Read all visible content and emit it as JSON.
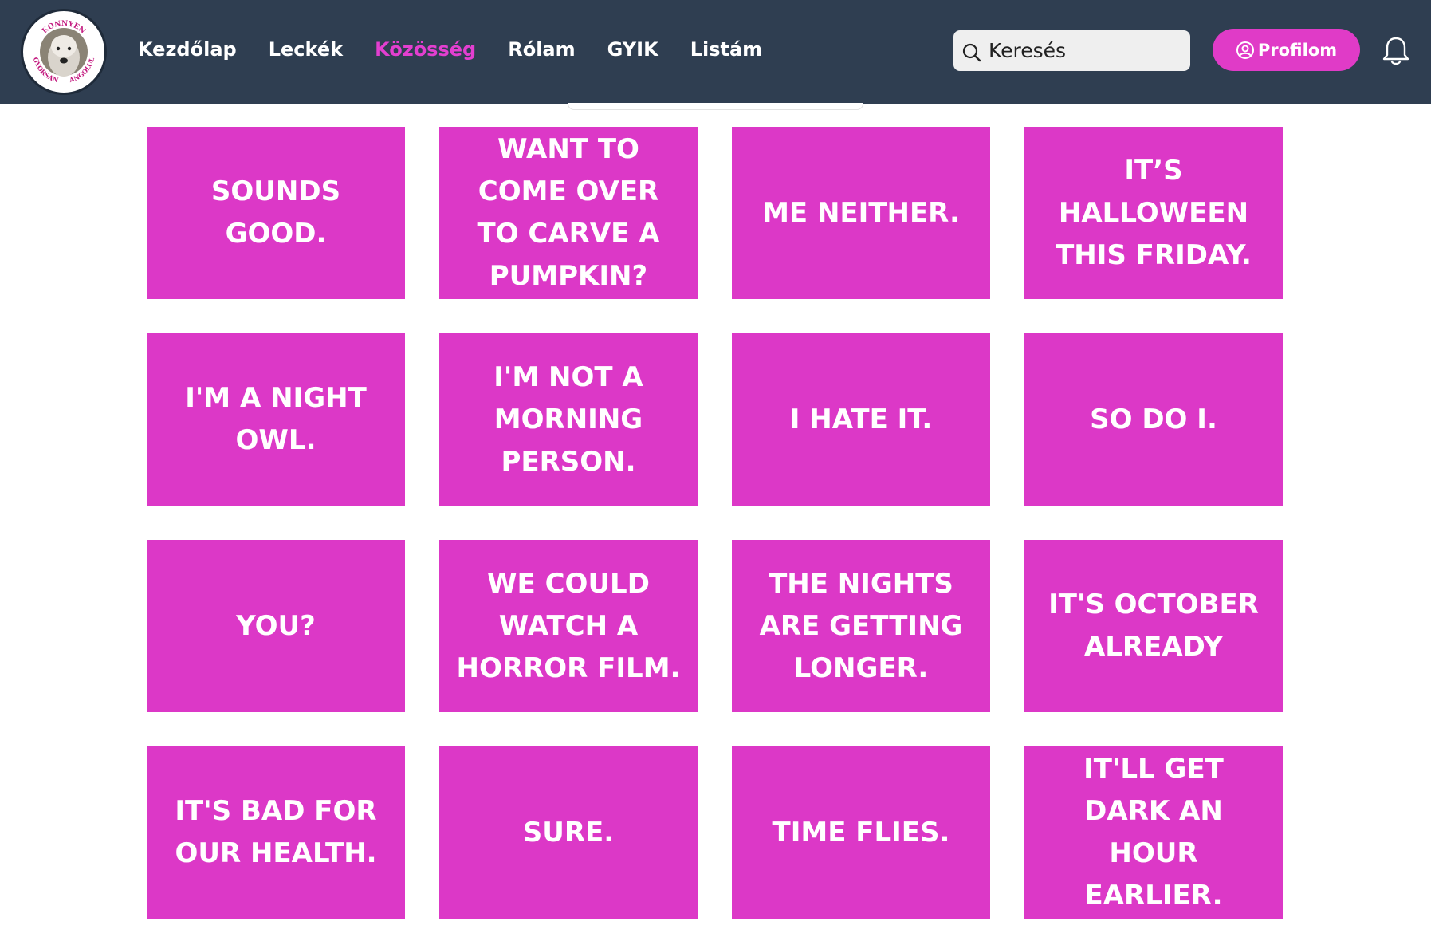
{
  "logo": {
    "top_text": "KONNYEN",
    "left_text": "GYORSAN",
    "right_text": "ANGOLUL"
  },
  "nav": [
    {
      "label": "Kezdőlap",
      "name": "nav-kezdolap",
      "active": false
    },
    {
      "label": "Leckék",
      "name": "nav-leckek",
      "active": false
    },
    {
      "label": "Közösség",
      "name": "nav-kozosseg",
      "active": true
    },
    {
      "label": "Rólam",
      "name": "nav-rolam",
      "active": false
    },
    {
      "label": "GYIK",
      "name": "nav-gyik",
      "active": false
    },
    {
      "label": "Listám",
      "name": "nav-listam",
      "active": false
    }
  ],
  "search": {
    "placeholder": "Keresés"
  },
  "profile": {
    "label": "Profilom"
  },
  "colors": {
    "navbar": "#2f3e51",
    "accent": "#e03bc7",
    "card": "#dc38c7"
  },
  "cards": [
    "SOUNDS GOOD.",
    "WANT TO COME OVER TO CARVE A PUMPKIN?",
    "ME NEITHER.",
    "IT’S HALLOWEEN THIS FRIDAY.",
    "I'M A NIGHT OWL.",
    "I'M NOT A MORNING PERSON.",
    "I HATE IT.",
    "SO DO I.",
    "YOU?",
    "WE COULD WATCH A HORROR FILM.",
    "THE NIGHTS ARE GETTING LONGER.",
    "IT'S OCTOBER ALREADY",
    "IT'S BAD FOR OUR HEALTH.",
    "SURE.",
    "TIME FLIES.",
    "IT'LL GET DARK AN HOUR EARLIER."
  ]
}
